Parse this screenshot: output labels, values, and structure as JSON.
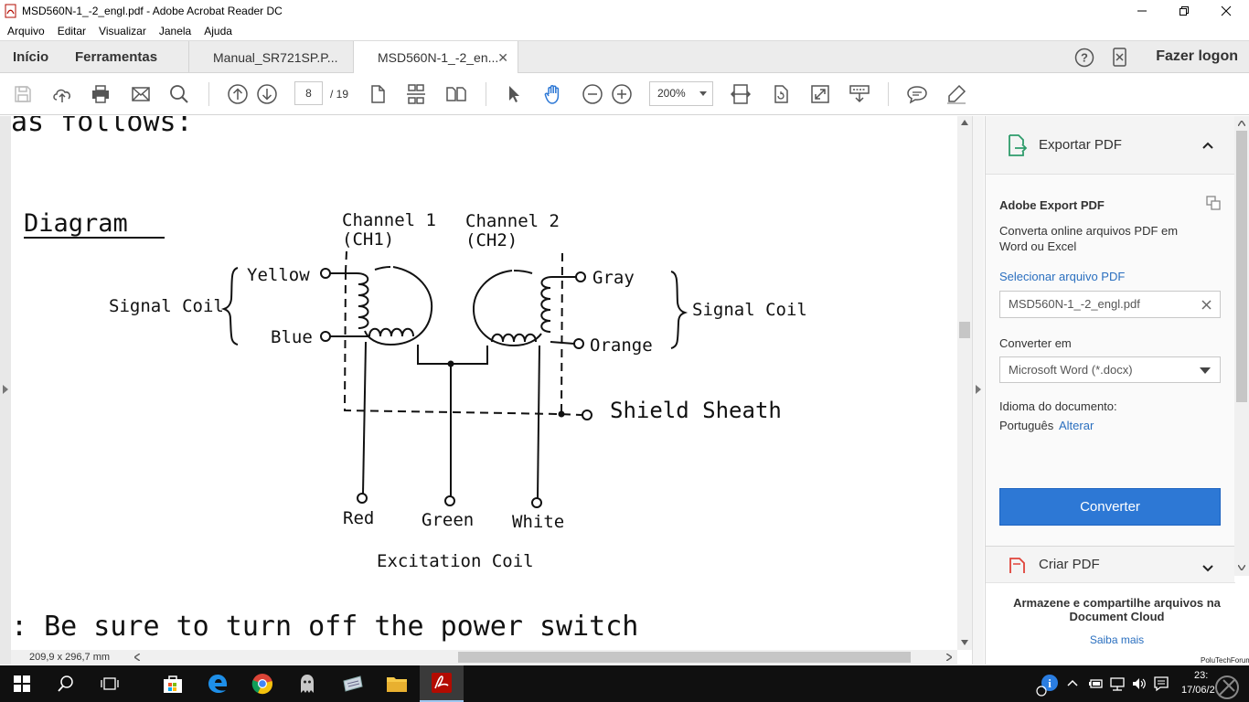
{
  "window": {
    "title": "MSD560N-1_-2_engl.pdf - Adobe Acrobat Reader DC"
  },
  "menu": {
    "items": [
      "Arquivo",
      "Editar",
      "Visualizar",
      "Janela",
      "Ajuda"
    ]
  },
  "tabs": {
    "home": "Início",
    "tools": "Ferramentas",
    "docs": [
      {
        "label": "Manual_SR721SP.P..."
      },
      {
        "label": "MSD560N-1_-2_en..."
      }
    ],
    "login": "Fazer logon"
  },
  "toolbar": {
    "page_current": "8",
    "page_total": "/ 19",
    "zoom": "200%"
  },
  "document": {
    "heading_fragment": "as follows:",
    "section_title": "Diagram",
    "ch1_line1": "Channel 1",
    "ch1_line2": "(CH1)",
    "ch2_line1": "Channel 2",
    "ch2_line2": "(CH2)",
    "signal_coil_left": "Signal Coil",
    "signal_coil_right": "Signal Coil",
    "yellow": "Yellow",
    "blue": "Blue",
    "gray": "Gray",
    "orange": "Orange",
    "shield": "Shield Sheath",
    "red": "Red",
    "green": "Green",
    "white": "White",
    "excitation": "Excitation Coil",
    "note_line": ":  Be sure to turn off the power switch"
  },
  "status": {
    "page_size": "209,9 x 296,7 mm"
  },
  "panel": {
    "export_header": "Exportar PDF",
    "box_title": "Adobe Export PDF",
    "desc_line1": "Converta online arquivos PDF em",
    "desc_line2": "Word ou Excel",
    "select_link": "Selecionar arquivo PDF",
    "file_name": "MSD560N-1_-2_engl.pdf",
    "convert_to_label": "Converter em",
    "convert_to_value": "Microsoft Word (*.docx)",
    "lang_label": "Idioma do documento:",
    "lang_value": "Português",
    "lang_change": "Alterar",
    "convert_button": "Converter",
    "create_pdf": "Criar PDF",
    "cloud_line1": "Armazene e compartilhe arquivos na",
    "cloud_line2": "Document Cloud",
    "learn_more": "Saiba mais"
  },
  "taskbar": {
    "clock_time": "23:",
    "clock_date": "17/06/2",
    "watermark": "PoluTechForum"
  },
  "colors": {
    "accent": "#2d78d5",
    "link": "#2a6fbf",
    "taskbar": "#101010"
  }
}
